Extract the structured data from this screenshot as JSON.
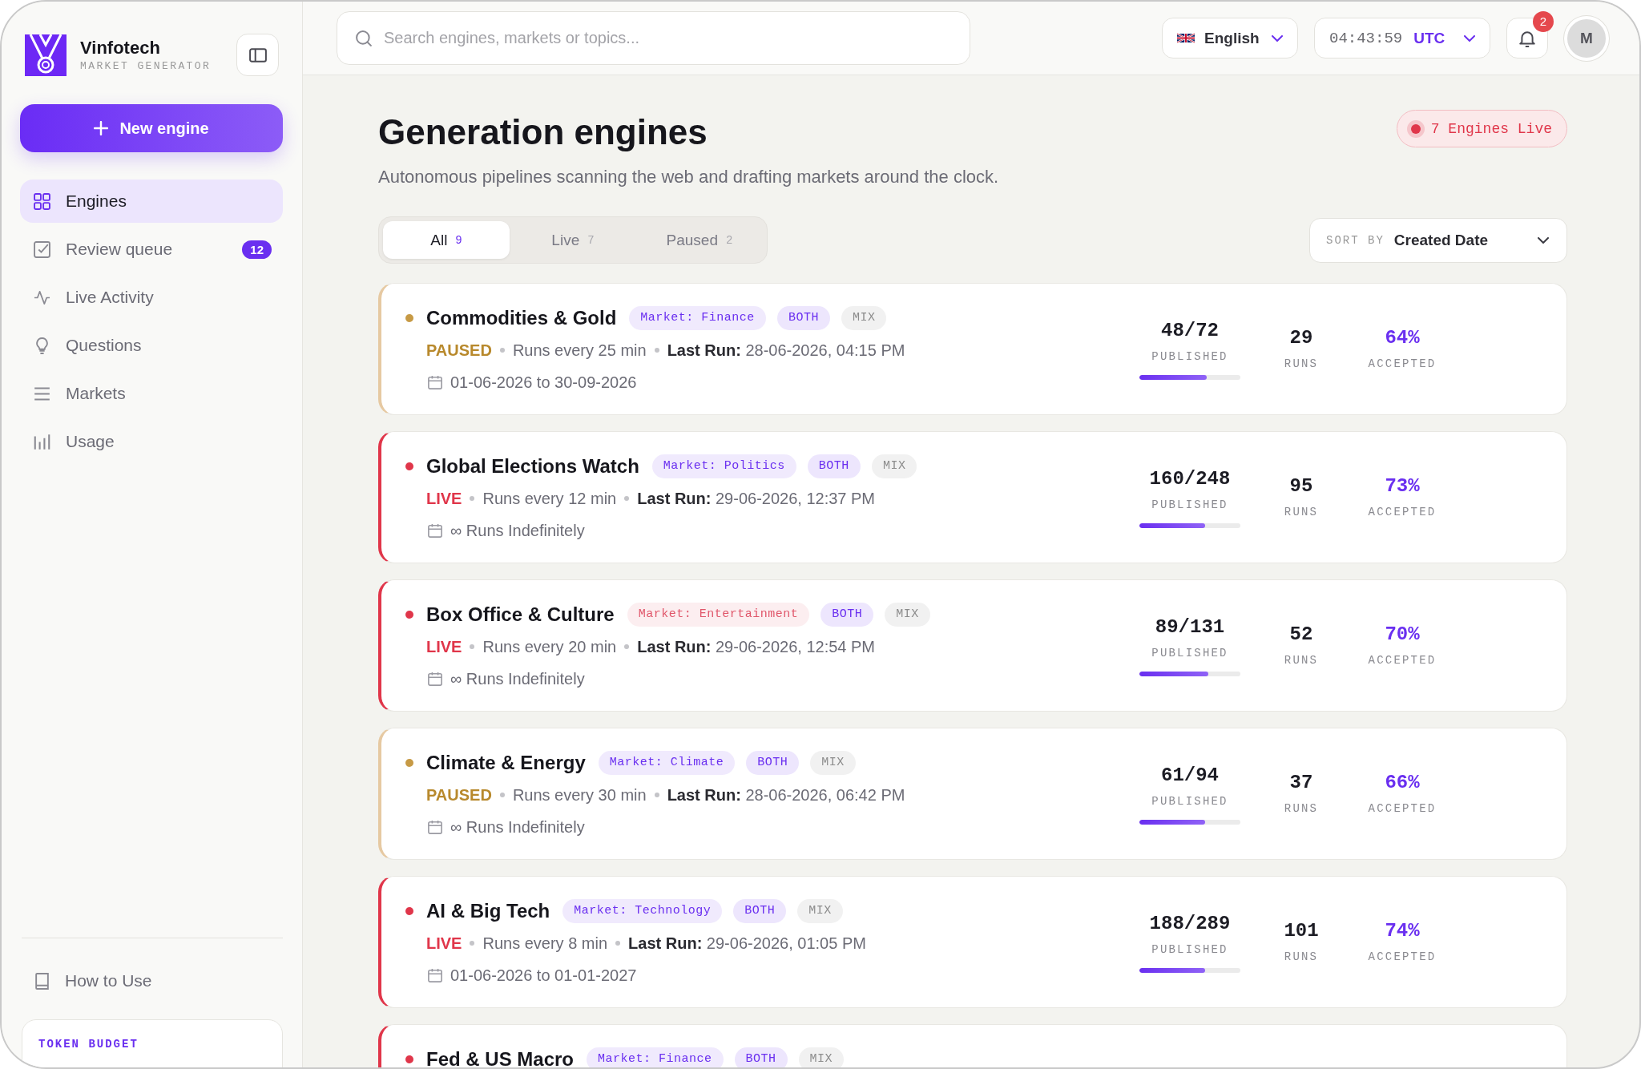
{
  "sidebar": {
    "brand": {
      "name": "Vinfotech",
      "tagline": "MARKET GENERATOR"
    },
    "new_button": "New engine",
    "nav": [
      {
        "label": "Engines",
        "selected": true
      },
      {
        "label": "Review queue",
        "badge": "12",
        "selected": false
      },
      {
        "label": "Live Activity",
        "selected": false
      },
      {
        "label": "Questions",
        "selected": false
      },
      {
        "label": "Markets",
        "selected": false
      },
      {
        "label": "Usage",
        "selected": false
      }
    ],
    "footer_link": "How to Use",
    "token_budget": {
      "title": "TOKEN BUDGET"
    }
  },
  "topbar": {
    "search": {
      "placeholder": "Search engines, markets or topics..."
    },
    "language": "English",
    "clock": {
      "time": "04:43:59",
      "zone": "UTC"
    },
    "notifications": {
      "count": "2"
    },
    "avatar": "M"
  },
  "header": {
    "title": "Generation engines",
    "subtitle": "Autonomous pipelines scanning the web and drafting markets around the clock.",
    "live_pill": "7 Engines Live"
  },
  "filter_tabs": [
    {
      "label": "All",
      "count": "9",
      "selected": true
    },
    {
      "label": "Live",
      "count": "7",
      "selected": false
    },
    {
      "label": "Paused",
      "count": "2",
      "selected": false
    }
  ],
  "sort": {
    "label": "SORT BY",
    "value": "Created Date"
  },
  "engines": [
    {
      "title": "Commodities & Gold",
      "live": false,
      "market": {
        "label": "Market: Finance",
        "color": "#6a2ff0"
      },
      "tags": [
        {
          "label": "BOTH",
          "color": "#6a2ff0"
        },
        {
          "label": "MIX",
          "color": "#8c8c8c"
        }
      ],
      "status": "PAUSED",
      "schedule": "Runs every 25 min",
      "last_run": "**Last Run:** 28-06-2026, 04:15 PM",
      "period": "01-06-2026 to 30-09-2026",
      "published": "48/72",
      "published_label": "PUBLISHED",
      "level": 0.67,
      "runs": "29",
      "runs_label": "RUNS",
      "accepted": "64%",
      "accepted_label": "ACCEPTED"
    },
    {
      "title": "Global Elections Watch",
      "live": true,
      "market": {
        "label": "Market: Politics",
        "color": "#6a2ff0"
      },
      "tags": [
        {
          "label": "BOTH",
          "color": "#6a2ff0"
        },
        {
          "label": "MIX",
          "color": "#8c8c8c"
        }
      ],
      "status": "LIVE",
      "schedule": "Runs every 12 min",
      "last_run": "**Last Run:** 29-06-2026, 12:37 PM",
      "period": "∞ Runs Indefinitely",
      "published": "160/248",
      "published_label": "PUBLISHED",
      "level": 0.65,
      "runs": "95",
      "runs_label": "RUNS",
      "accepted": "73%",
      "accepted_label": "ACCEPTED"
    },
    {
      "title": "Box Office & Culture",
      "live": true,
      "market": {
        "label": "Market: Entertainment",
        "color": "#e0566a"
      },
      "tags": [
        {
          "label": "BOTH",
          "color": "#6a2ff0"
        },
        {
          "label": "MIX",
          "color": "#8c8c8c"
        }
      ],
      "status": "LIVE",
      "schedule": "Runs every 20 min",
      "last_run": "**Last Run:** 29-06-2026, 12:54 PM",
      "period": "∞ Runs Indefinitely",
      "published": "89/131",
      "published_label": "PUBLISHED",
      "level": 0.68,
      "runs": "52",
      "runs_label": "RUNS",
      "accepted": "70%",
      "accepted_label": "ACCEPTED"
    },
    {
      "title": "Climate & Energy",
      "live": false,
      "market": {
        "label": "Market: Climate",
        "color": "#6a2ff0"
      },
      "tags": [
        {
          "label": "BOTH",
          "color": "#6a2ff0"
        },
        {
          "label": "MIX",
          "color": "#8c8c8c"
        }
      ],
      "status": "PAUSED",
      "schedule": "Runs every 30 min",
      "last_run": "**Last Run:** 28-06-2026, 06:42 PM",
      "period": "∞ Runs Indefinitely",
      "published": "61/94",
      "published_label": "PUBLISHED",
      "level": 0.65,
      "runs": "37",
      "runs_label": "RUNS",
      "accepted": "66%",
      "accepted_label": "ACCEPTED"
    },
    {
      "title": "AI & Big Tech",
      "live": true,
      "market": {
        "label": "Market: Technology",
        "color": "#6a2ff0"
      },
      "tags": [
        {
          "label": "BOTH",
          "color": "#6a2ff0"
        },
        {
          "label": "MIX",
          "color": "#8c8c8c"
        }
      ],
      "status": "LIVE",
      "schedule": "Runs every 8 min",
      "last_run": "**Last Run:** 29-06-2026, 01:05 PM",
      "period": "01-06-2026 to 01-01-2027",
      "published": "188/289",
      "published_label": "PUBLISHED",
      "level": 0.65,
      "runs": "101",
      "runs_label": "RUNS",
      "accepted": "74%",
      "accepted_label": "ACCEPTED"
    },
    {
      "title": "Fed & US Macro",
      "live": true,
      "market": {
        "label": "Market: Finance",
        "color": "#6a2ff0"
      },
      "tags": [
        {
          "label": "BOTH",
          "color": "#6a2ff0"
        },
        {
          "label": "MIX",
          "color": "#8c8c8c"
        }
      ]
    }
  ]
}
